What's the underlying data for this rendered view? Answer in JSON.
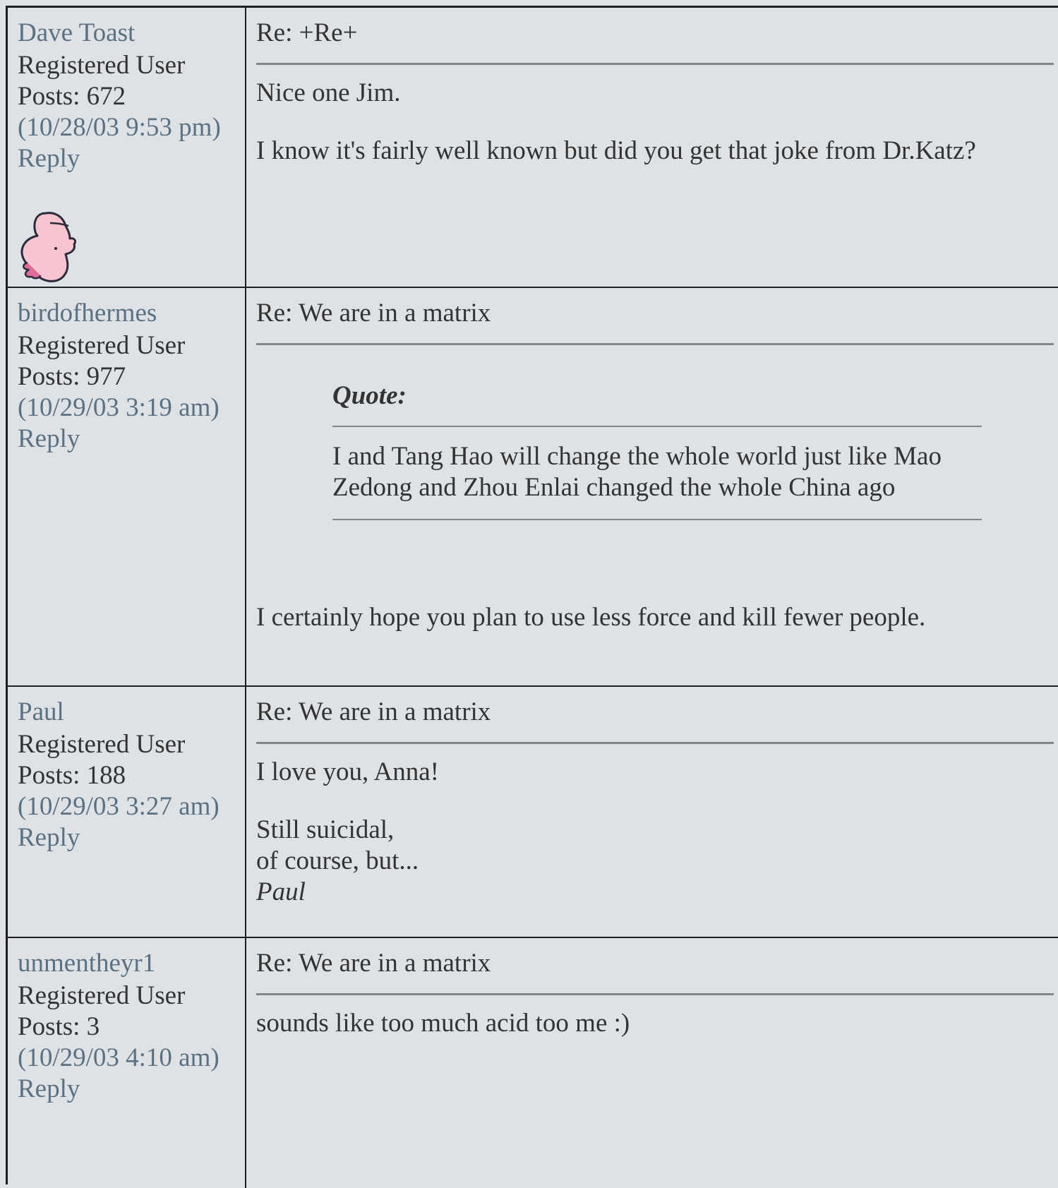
{
  "posts": [
    {
      "username": "Dave Toast",
      "role": "Registered User",
      "posts_count": "Posts: 672",
      "timestamp": "(10/28/03 9:53 pm)",
      "reply_label": "Reply",
      "avatar_icon": "pink-cartoon-face-icon",
      "subject": "Re: +Re+",
      "body": [
        "Nice one Jim.",
        "I know it's fairly well known but did you get that joke from Dr.Katz?"
      ]
    },
    {
      "username": "birdofhermes",
      "role": "Registered User",
      "posts_count": "Posts: 977",
      "timestamp": "(10/29/03 3:19 am)",
      "reply_label": "Reply",
      "subject": "Re: We are in a matrix",
      "quote_label": "Quote:",
      "quote_lines": [
        "I and Tang Hao will change the whole world just like Mao",
        "Zedong and Zhou Enlai changed the whole China ago"
      ],
      "body_after_quote": "I certainly hope you plan to use less force and kill fewer people."
    },
    {
      "username": "Paul",
      "role": "Registered User",
      "posts_count": "Posts: 188",
      "timestamp": "(10/29/03 3:27 am)",
      "reply_label": "Reply",
      "subject": "Re: We are in a matrix",
      "body": [
        "I love you, Anna!"
      ],
      "signature": [
        "Still suicidal,",
        "of course, but...",
        "Paul"
      ]
    },
    {
      "username": "unmentheyr1",
      "role": "Registered User",
      "posts_count": "Posts: 3",
      "timestamp": "(10/29/03 4:10 am)",
      "reply_label": "Reply",
      "subject": "Re: We are in a matrix",
      "body": [
        "sounds like too much acid too me :)"
      ]
    }
  ]
}
